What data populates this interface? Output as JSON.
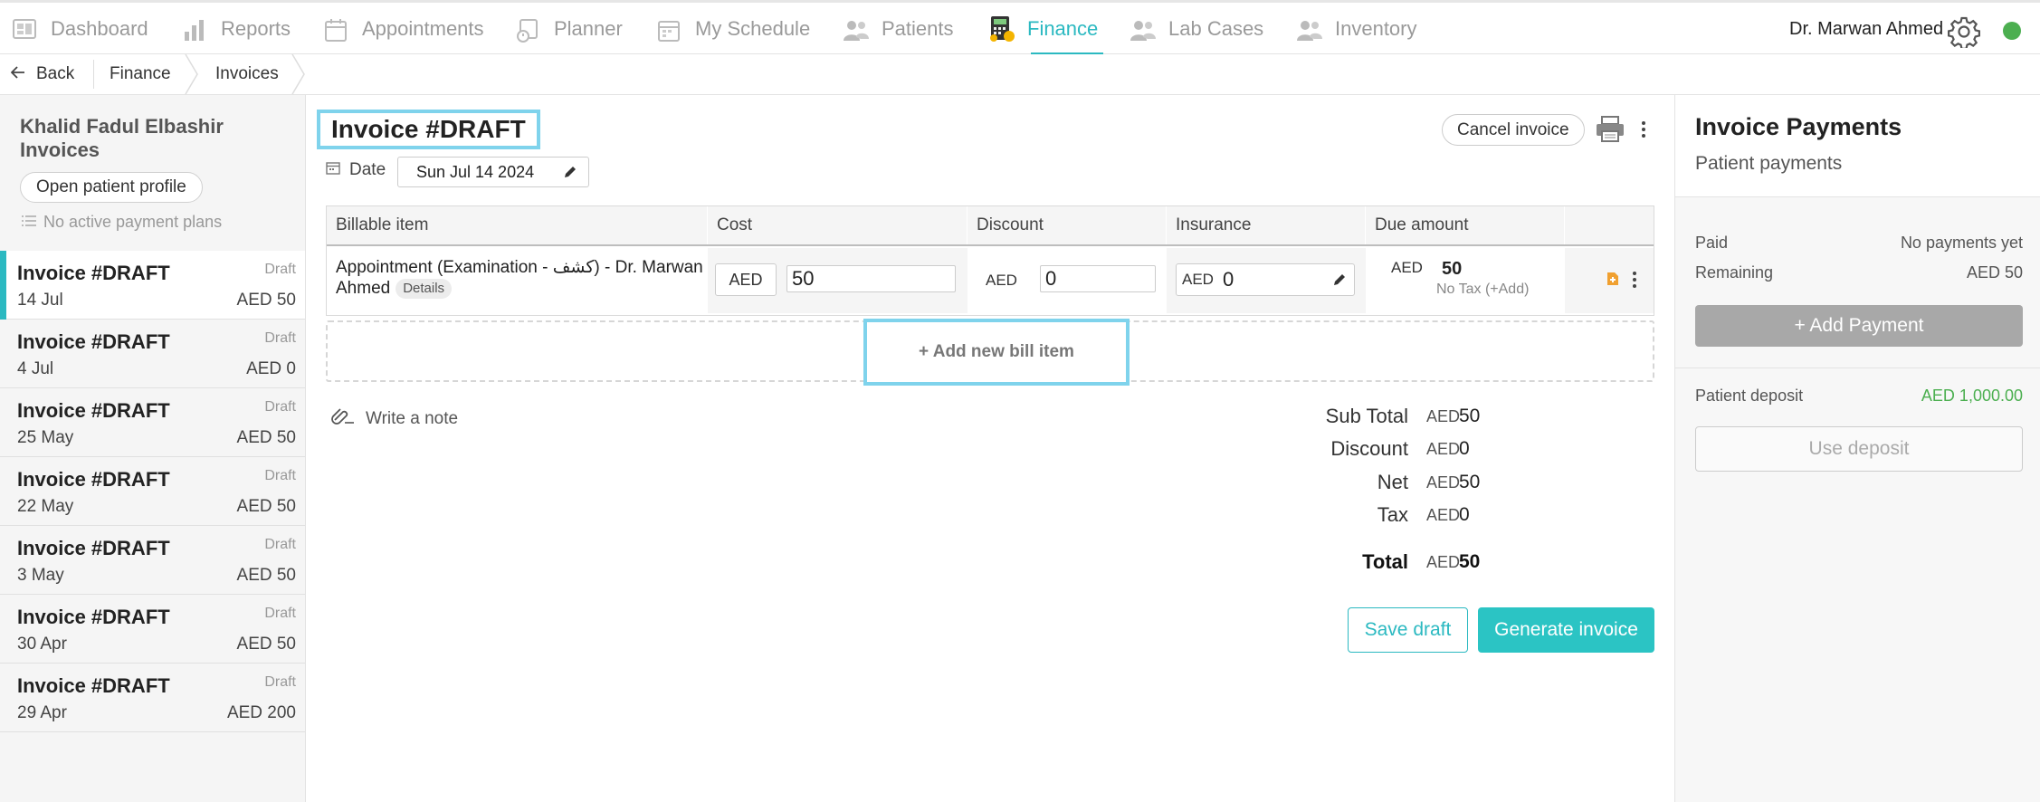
{
  "nav": {
    "items": [
      {
        "label": "Dashboard",
        "icon": "dashboard-icon"
      },
      {
        "label": "Reports",
        "icon": "reports-icon"
      },
      {
        "label": "Appointments",
        "icon": "appointments-icon"
      },
      {
        "label": "Planner",
        "icon": "planner-icon"
      },
      {
        "label": "My Schedule",
        "icon": "schedule-icon"
      },
      {
        "label": "Patients",
        "icon": "patients-icon"
      },
      {
        "label": "Finance",
        "icon": "finance-icon",
        "active": true
      },
      {
        "label": "Lab Cases",
        "icon": "lab-cases-icon"
      },
      {
        "label": "Inventory",
        "icon": "inventory-icon"
      }
    ],
    "user_name": "Dr. Marwan Ahmed",
    "accent_color": "#2bb9c1",
    "status_color": "#4caf50"
  },
  "breadcrumb": {
    "back": "Back",
    "items": [
      "Finance",
      "Invoices"
    ]
  },
  "sidebar": {
    "patient_name": "Khalid Fadul Elbashir",
    "section_title": "Invoices",
    "open_profile": "Open patient profile",
    "no_plans": "No active payment plans",
    "invoices": [
      {
        "title": "Invoice #DRAFT",
        "status": "Draft",
        "date": "14 Jul",
        "amount": "AED 50",
        "selected": true
      },
      {
        "title": "Invoice #DRAFT",
        "status": "Draft",
        "date": "4 Jul",
        "amount": "AED 0"
      },
      {
        "title": "Invoice #DRAFT",
        "status": "Draft",
        "date": "25 May",
        "amount": "AED 50"
      },
      {
        "title": "Invoice #DRAFT",
        "status": "Draft",
        "date": "22 May",
        "amount": "AED 50"
      },
      {
        "title": "Invoice #DRAFT",
        "status": "Draft",
        "date": "3 May",
        "amount": "AED 50"
      },
      {
        "title": "Invoice #DRAFT",
        "status": "Draft",
        "date": "30 Apr",
        "amount": "AED 50"
      },
      {
        "title": "Invoice #DRAFT",
        "status": "Draft",
        "date": "29 Apr",
        "amount": "AED 200"
      }
    ]
  },
  "invoice": {
    "title": "Invoice #DRAFT",
    "date_label": "Date",
    "date_value": "Sun Jul 14 2024",
    "cancel_label": "Cancel invoice",
    "columns": [
      "Billable item",
      "Cost",
      "Discount",
      "Insurance",
      "Due amount"
    ],
    "row": {
      "item": "Appointment (Examination - كشف) - Dr. Marwan Ahmed",
      "details_label": "Details",
      "cost_currency": "AED",
      "cost_value": "50",
      "discount_currency": "AED",
      "discount_value": "0",
      "insurance_currency": "AED",
      "insurance_value": "0",
      "due_currency": "AED",
      "due_value": "50",
      "tax_note": "No Tax (+Add)"
    },
    "add_item_label": "+ Add new bill item",
    "note_label": "Write a note",
    "totals": [
      {
        "label": "Sub Total",
        "currency": "AED",
        "value": "50"
      },
      {
        "label": "Discount",
        "currency": "AED",
        "value": "0"
      },
      {
        "label": "Net",
        "currency": "AED",
        "value": "50"
      },
      {
        "label": "Tax",
        "currency": "AED",
        "value": "0"
      },
      {
        "label": "Total",
        "currency": "AED",
        "value": "50"
      }
    ],
    "save_draft_label": "Save draft",
    "generate_label": "Generate invoice"
  },
  "payments": {
    "title": "Invoice Payments",
    "subtitle": "Patient payments",
    "paid_label": "Paid",
    "paid_value": "No payments yet",
    "remaining_label": "Remaining",
    "remaining_value": "AED 50",
    "add_payment_label": "+ Add Payment",
    "deposit_label": "Patient deposit",
    "deposit_value": "AED 1,000.00",
    "use_deposit_label": "Use deposit"
  }
}
